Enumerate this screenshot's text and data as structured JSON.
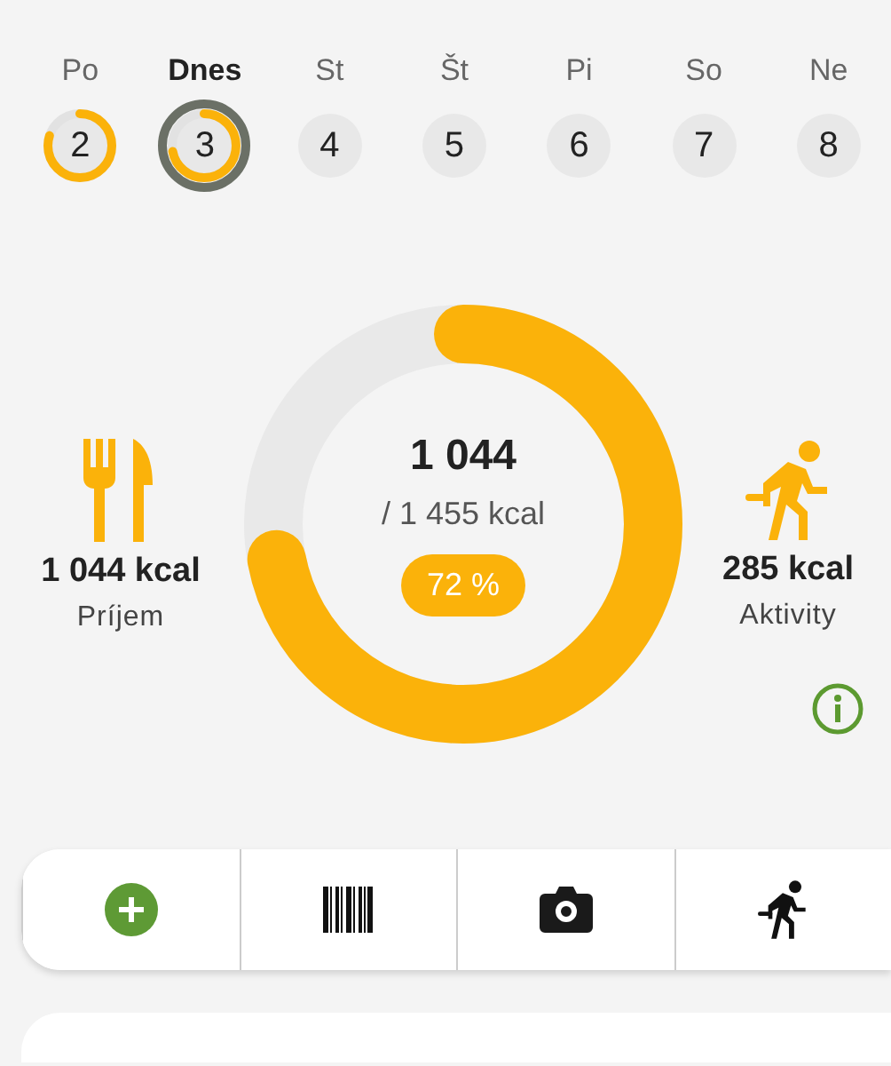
{
  "days": [
    {
      "label": "Po",
      "number": "2",
      "level": 0.8,
      "selected": false
    },
    {
      "label": "Dnes",
      "number": "3",
      "level": 0.72,
      "selected": true
    },
    {
      "label": "St",
      "number": "4",
      "selected": false
    },
    {
      "label": "Št",
      "number": "5",
      "selected": false
    },
    {
      "label": "Pi",
      "number": "6",
      "selected": false
    },
    {
      "label": "So",
      "number": "7",
      "selected": false
    },
    {
      "label": "Ne",
      "number": "8",
      "selected": false
    }
  ],
  "summary": {
    "intake": {
      "value": "1 044 kcal",
      "label": "Príjem"
    },
    "eaten": "1 044",
    "goal": "/ 1 455 kcal",
    "percent": "72 %",
    "level": 0.72,
    "activity": {
      "value": "285 kcal",
      "label": "Aktivity"
    }
  },
  "actions": [
    {
      "kind": "add"
    },
    {
      "kind": "barcode"
    },
    {
      "kind": "camera"
    },
    {
      "kind": "activity"
    }
  ]
}
